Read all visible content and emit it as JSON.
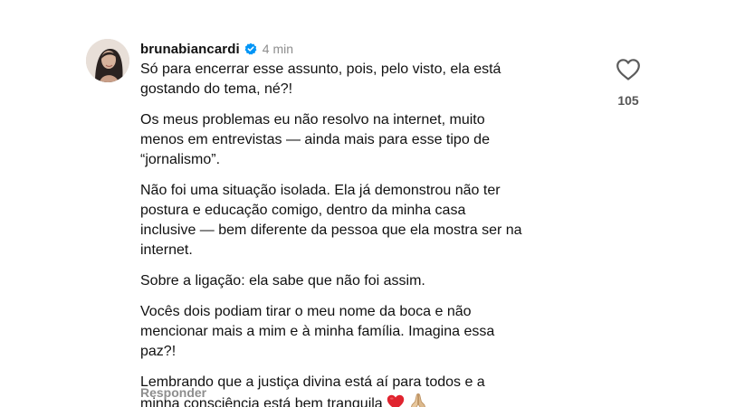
{
  "comment": {
    "username": "brunabiancardi",
    "verified": true,
    "time": "4 min",
    "paragraphs": [
      {
        "lines": [
          "Só para encerrar esse assunto, pois, pelo visto, ela está",
          "gostando do tema, né?!"
        ]
      },
      {
        "lines": [
          "Os meus problemas eu não resolvo na internet, muito",
          "menos em entrevistas — ainda mais para esse tipo de",
          "“jornalismo”."
        ]
      },
      {
        "lines": [
          "Não foi uma situação isolada. Ela já demonstrou não ter",
          "postura e educação comigo, dentro da minha casa",
          "inclusive — bem diferente da pessoa que ela mostra ser na",
          "internet."
        ]
      },
      {
        "lines": [
          "Sobre a ligação: ela sabe que não foi assim."
        ]
      },
      {
        "lines": [
          "Vocês dois podiam tirar o meu nome da boca e não",
          "mencionar mais a mim e à minha família. Imagina essa",
          "paz?!"
        ]
      },
      {
        "lines": [
          "Lembrando que a justiça divina está aí para todos e a",
          "minha consciência está bem tranquila"
        ]
      }
    ],
    "emojis": [
      "red-heart-icon",
      "praying-hands-icon"
    ],
    "reply_label": "Responder",
    "like_count": "105"
  },
  "colors": {
    "text": "#111111",
    "muted": "#8e8e8e",
    "verified_blue": "#0095f6",
    "heart_red": "#e0242f"
  }
}
